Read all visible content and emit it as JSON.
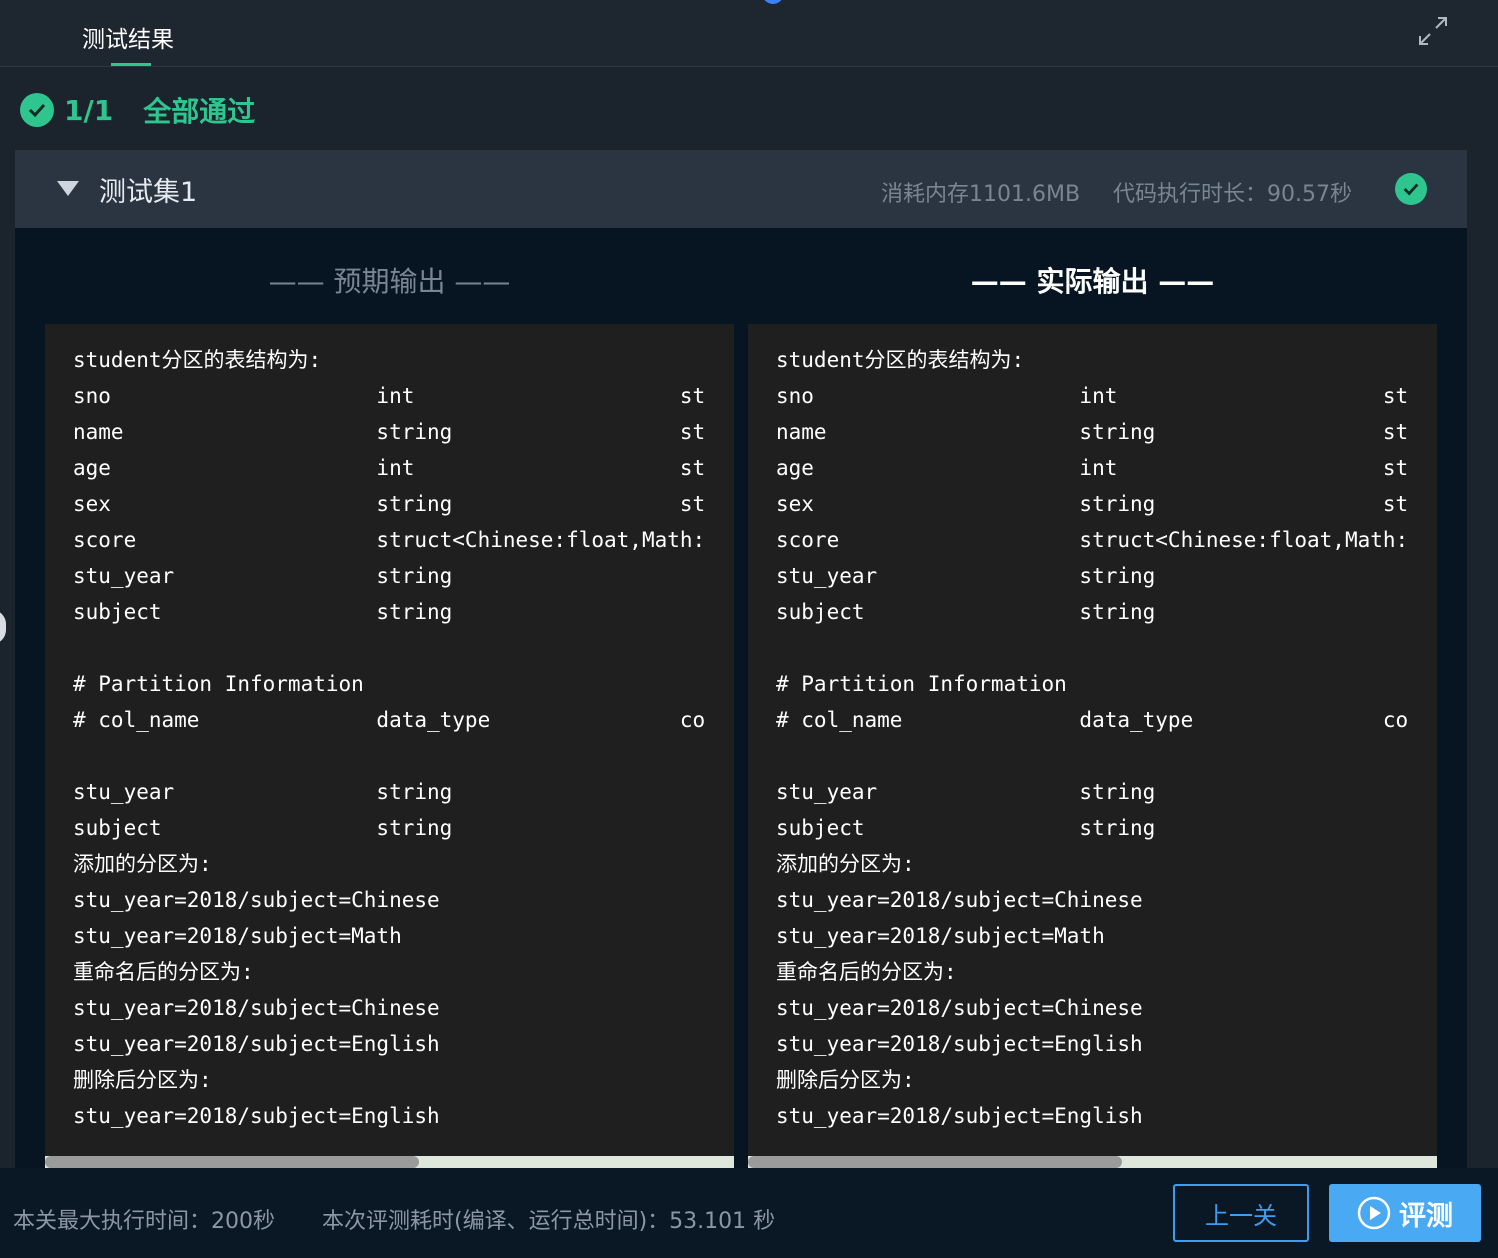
{
  "header": {
    "tab_label": "测试结果"
  },
  "summary": {
    "count": "1/1",
    "status": "全部通过"
  },
  "test_set": {
    "title": "测试集1",
    "memory": "消耗内存1101.6MB",
    "exec_time": "代码执行时长：90.57秒"
  },
  "expected": {
    "title": "—— 预期输出 ——",
    "lines": [
      "student分区的表结构为:",
      "sno                     int                     st",
      "name                    string                  st",
      "age                     int                     st",
      "sex                     string                  st",
      "score                   struct<Chinese:float,Math:",
      "stu_year                string",
      "subject                 string",
      " ",
      "# Partition Information",
      "# col_name              data_type               co",
      " ",
      "stu_year                string",
      "subject                 string",
      "添加的分区为:",
      "stu_year=2018/subject=Chinese",
      "stu_year=2018/subject=Math",
      "重命名后的分区为:",
      "stu_year=2018/subject=Chinese",
      "stu_year=2018/subject=English",
      "删除后分区为:",
      "stu_year=2018/subject=English"
    ]
  },
  "actual": {
    "title": "—— 实际输出 ——",
    "lines": [
      "student分区的表结构为:",
      "sno                     int                     st",
      "name                    string                  st",
      "age                     int                     st",
      "sex                     string                  st",
      "score                   struct<Chinese:float,Math:",
      "stu_year                string",
      "subject                 string",
      " ",
      "# Partition Information",
      "# col_name              data_type               co",
      " ",
      "stu_year                string",
      "subject                 string",
      "添加的分区为:",
      "stu_year=2018/subject=Chinese",
      "stu_year=2018/subject=Math",
      "重命名后的分区为:",
      "stu_year=2018/subject=Chinese",
      "stu_year=2018/subject=English",
      "删除后分区为:",
      "stu_year=2018/subject=English"
    ]
  },
  "footer": {
    "max_time": "本关最大执行时间：200秒",
    "eval_time": "本次评测耗时(编译、运行总时间)：53.101 秒",
    "prev_label": "上一关",
    "eval_label": "评测"
  },
  "colors": {
    "accent_green": "#2fc58f",
    "accent_blue": "#49a9f2"
  }
}
